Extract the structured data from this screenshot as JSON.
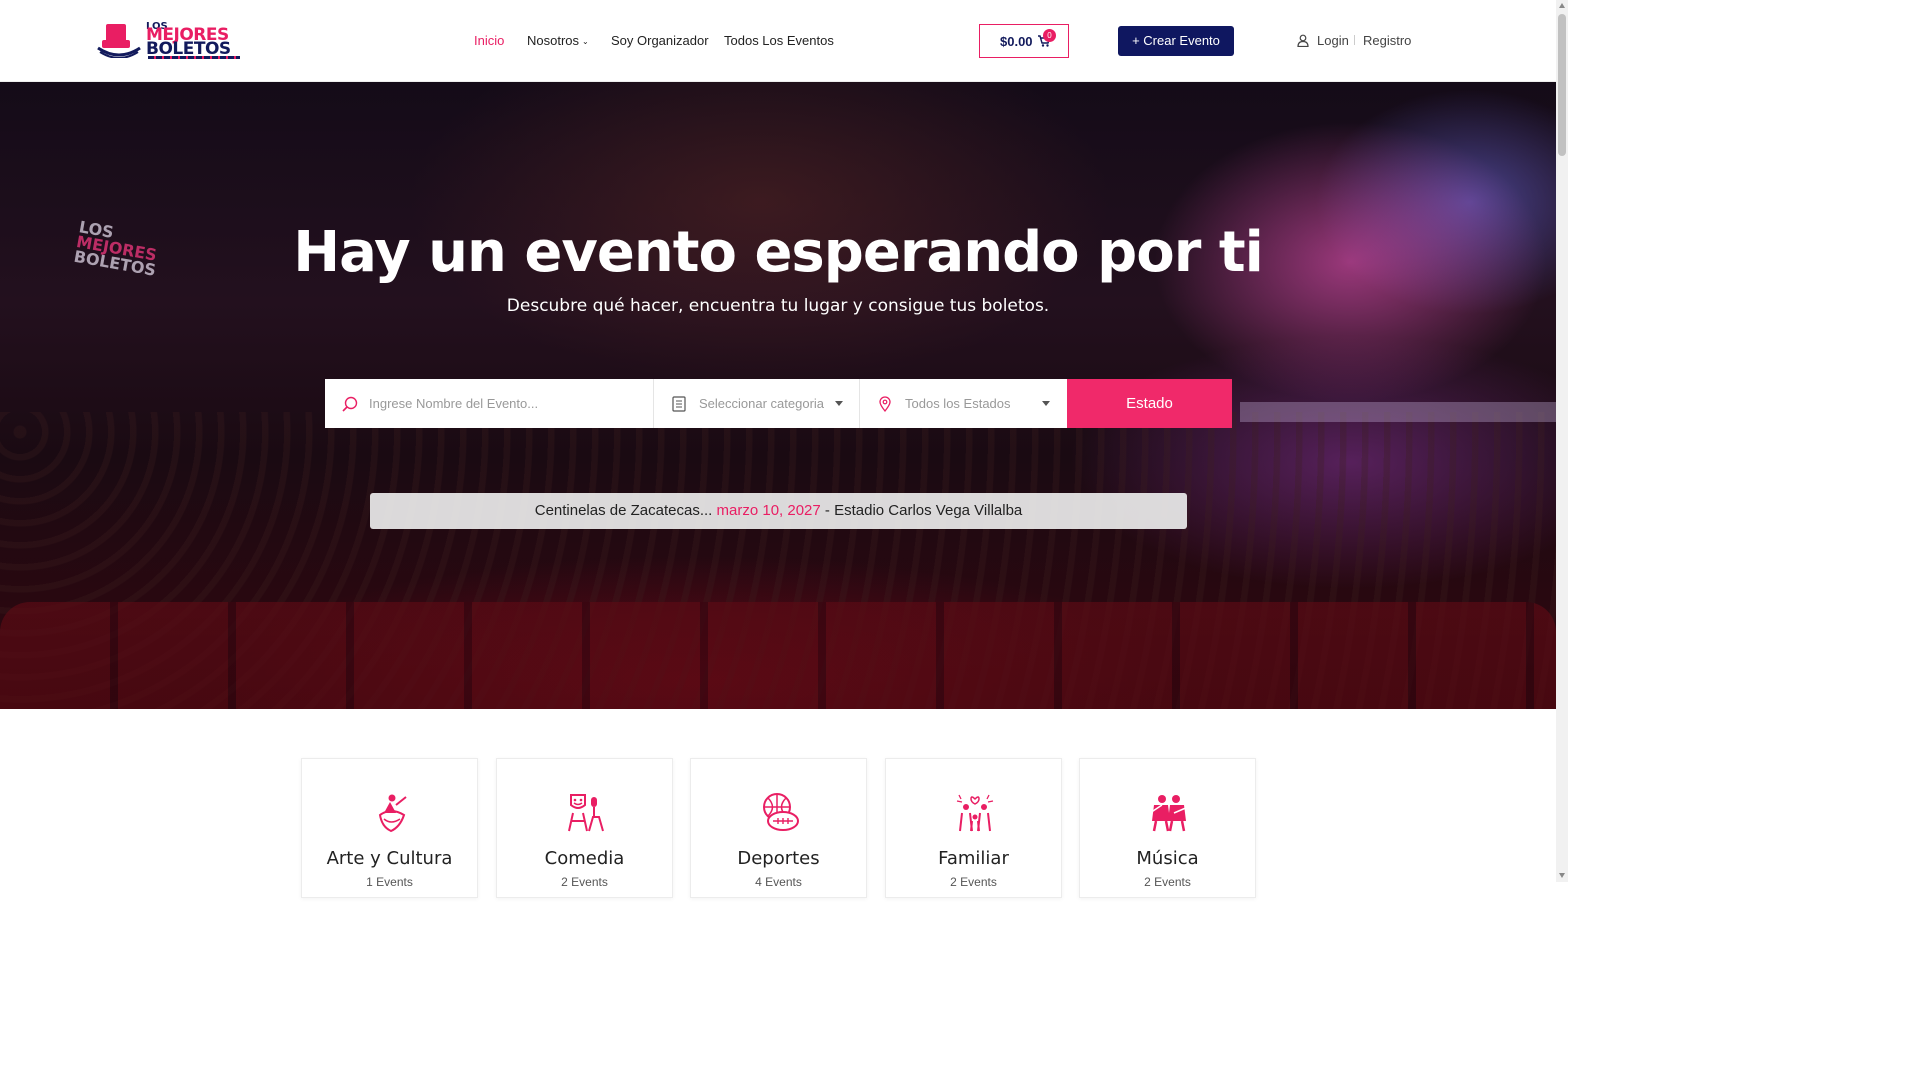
{
  "header": {
    "logo": {
      "line1": "LOS",
      "line2": "MEJORES",
      "line3": "BOLETOS"
    },
    "nav": [
      {
        "label": "Inicio",
        "active": true
      },
      {
        "label": "Nosotros",
        "has_dropdown": true
      },
      {
        "label": "Soy Organizador"
      },
      {
        "label": "Todos Los Eventos"
      }
    ],
    "cart": {
      "amount": "$0.00",
      "count": "0"
    },
    "create_event_label": "+ Crear Evento",
    "login_label": "Login",
    "register_label": "Registro"
  },
  "hero": {
    "watermark": {
      "line1": "LOS",
      "line2": "MEJORES",
      "line3": "BOLETOS"
    },
    "title": "Hay un evento esperando por ti",
    "subtitle": "Descubre qué hacer, encuentra tu lugar y consigue tus boletos.",
    "search": {
      "name_placeholder": "Ingrese Nombre del Evento...",
      "category_placeholder": "Seleccionar categoria",
      "state_placeholder": "Todos los Estados",
      "button_label": "Estado"
    },
    "ticker": {
      "event": "Centinelas de Zacatecas...",
      "date": "marzo 10, 2027",
      "venue": "- Estadio Carlos Vega Villalba"
    }
  },
  "categories": [
    {
      "name": "Arte y Cultura",
      "count": "1 Events",
      "icon": "dancer-icon"
    },
    {
      "name": "Comedia",
      "count": "2 Events",
      "icon": "comedy-icon"
    },
    {
      "name": "Deportes",
      "count": "4 Events",
      "icon": "sports-ball-icon"
    },
    {
      "name": "Familiar",
      "count": "2 Events",
      "icon": "family-icon"
    },
    {
      "name": "Música",
      "count": "2 Events",
      "icon": "musicians-icon"
    }
  ],
  "colors": {
    "brand_pink": "#e91e63",
    "brand_navy": "#0f1760",
    "search_button": "#f0296a"
  }
}
